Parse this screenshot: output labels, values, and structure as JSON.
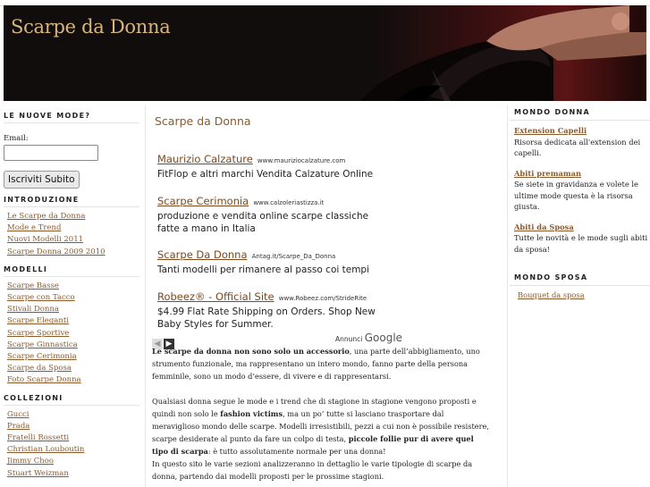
{
  "header": {
    "site_title": "Scarpe da Donna"
  },
  "newsletter": {
    "heading": "LE NUOVE MODE?",
    "email_label": "Email:",
    "email_value": "",
    "submit_label": "Iscriviti Subito"
  },
  "intro": {
    "heading": "INTRODUZIONE",
    "items": [
      "Le Scarpe da Donna",
      "Mode e Trend",
      "Nuovi Modelli 2011",
      "Scarpe Donna 2009 2010"
    ]
  },
  "models": {
    "heading": "MODELLI",
    "items": [
      "Scarpe Basse",
      "Scarpe con Tacco",
      "Stivali Donna",
      "Scarpe Eleganti",
      "Scarpe Sportive",
      "Scarpe Ginnastica",
      "Scarpe Cerimonia",
      "Scarpe da Sposa",
      "Foto Scarpe Donna"
    ]
  },
  "collections": {
    "heading": "COLLEZIONI",
    "items": [
      "Gucci",
      "Prada",
      "Fratelli Rossetti",
      "Christian Louboutin",
      "Jimmy Choo",
      "Stuart Weizman"
    ]
  },
  "main": {
    "title": "Scarpe da Donna",
    "ads": [
      {
        "title": "Maurizio Calzature",
        "url": "www.mauriziocalzature.com",
        "text": "FitFlop e altri marchi Vendita Calzature Online"
      },
      {
        "title": "Scarpe Cerimonia",
        "url": "www.calzoleriastizza.it",
        "text": "produzione e vendita online scarpe classiche fatte a mano in Italia"
      },
      {
        "title": "Scarpe Da Donna",
        "url": "Antag.it/Scarpe_Da_Donna",
        "text": "Tanti modelli per rimanere al passo coi tempi"
      },
      {
        "title": "Robeez® - Official Site",
        "url": "www.Robeez.com/StrideRite",
        "text": "$4.99 Flat Rate Shipping on Orders. Shop New Baby Styles for Summer."
      }
    ],
    "ads_by_prefix": "Annunci",
    "ads_by_brand": "Google",
    "p1_bold": "Le scarpe da donna non sono solo un accessorio",
    "p1_rest": ", una parte dell’abbigliamento, uno strumento funzionale, ma rappresentano un intero mondo, fanno parte della persona femminile, sono un modo d’essere, di vivere e di rappresentarsi.",
    "p2_a": "Qualsiasi donna segue le mode e i trend che di stagione in stagione vengono proposti e quindi non solo le ",
    "p2_bold1": "fashion victims",
    "p2_b": ", ma un po’ tutte si lasciano trasportare dal meraviglioso mondo delle scarpe. Modelli irresistibili, pezzi a cui non è possibile resistere, scarpe desiderate al punto da fare un colpo di testa, ",
    "p2_bold2": "piccole follie pur di avere quel tipo di scarpa",
    "p2_c": ": è tutto assolutamente normale per una donna!",
    "p2_d": "In questo sito le varie sezioni analizzeranno in dettaglio le varie tipologie di scarpe da donna, partendo dai modelli proposti per le prossime stagioni."
  },
  "right": {
    "mondo_donna_heading": "MONDO DONNA",
    "items": [
      {
        "title": "Extension Capelli",
        "desc": "Risorsa dedicata all'extension dei capelli."
      },
      {
        "title": "Abiti premaman",
        "desc": "Se siete in gravidanza e volete le ultime mode questa è la risorsa giusta."
      },
      {
        "title": "Abiti da Sposa",
        "desc": "Tutte le novità e le mode sugli abiti da sposa!"
      }
    ],
    "mondo_sposa_heading": "MONDO SPOSA",
    "sposa_items": [
      "Bouquet da sposa"
    ]
  },
  "colors": {
    "link": "#8b5a2b",
    "title": "#d8b57d",
    "banner": "#120d0d"
  }
}
